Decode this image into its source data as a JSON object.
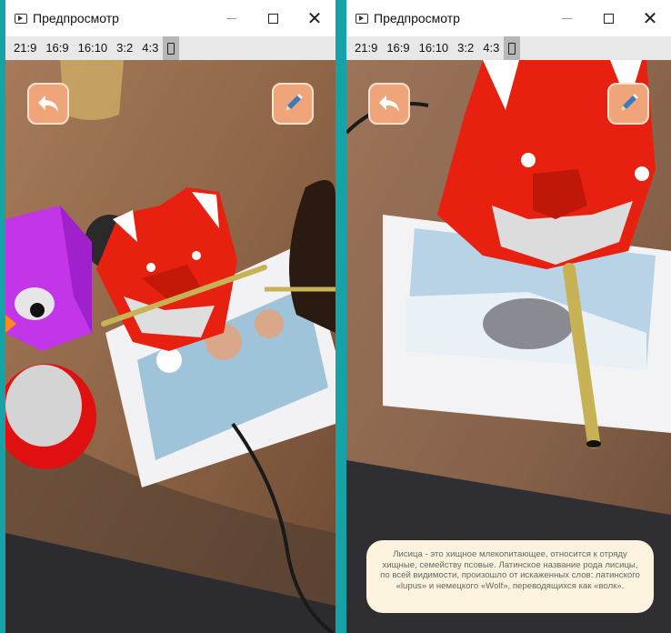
{
  "windows": [
    {
      "title": "Предпросмотр",
      "ratios": [
        "21:9",
        "16:9",
        "16:10",
        "3:2",
        "4:3"
      ],
      "selected_ratio": "portrait",
      "buttons": {
        "back": "back-arrow-icon",
        "edit": "pencil-icon"
      }
    },
    {
      "title": "Предпросмотр",
      "ratios": [
        "21:9",
        "16:9",
        "16:10",
        "3:2",
        "4:3"
      ],
      "selected_ratio": "portrait",
      "buttons": {
        "back": "back-arrow-icon",
        "edit": "pencil-icon"
      },
      "info_text": "Лисица - это хищное млекопитающее, относится к отряду хищные, семейству псовые. Латинское название рода лисицы, по всей видимости, произошло от искаженных слов: латинского «lupus» и немецкого «Wolf», переводящихся как «волк»."
    }
  ],
  "colors": {
    "desktop": "#16a3a8",
    "button": "#f0a47a",
    "fox": "#e8200f",
    "info_bg": "#fbf3de"
  }
}
